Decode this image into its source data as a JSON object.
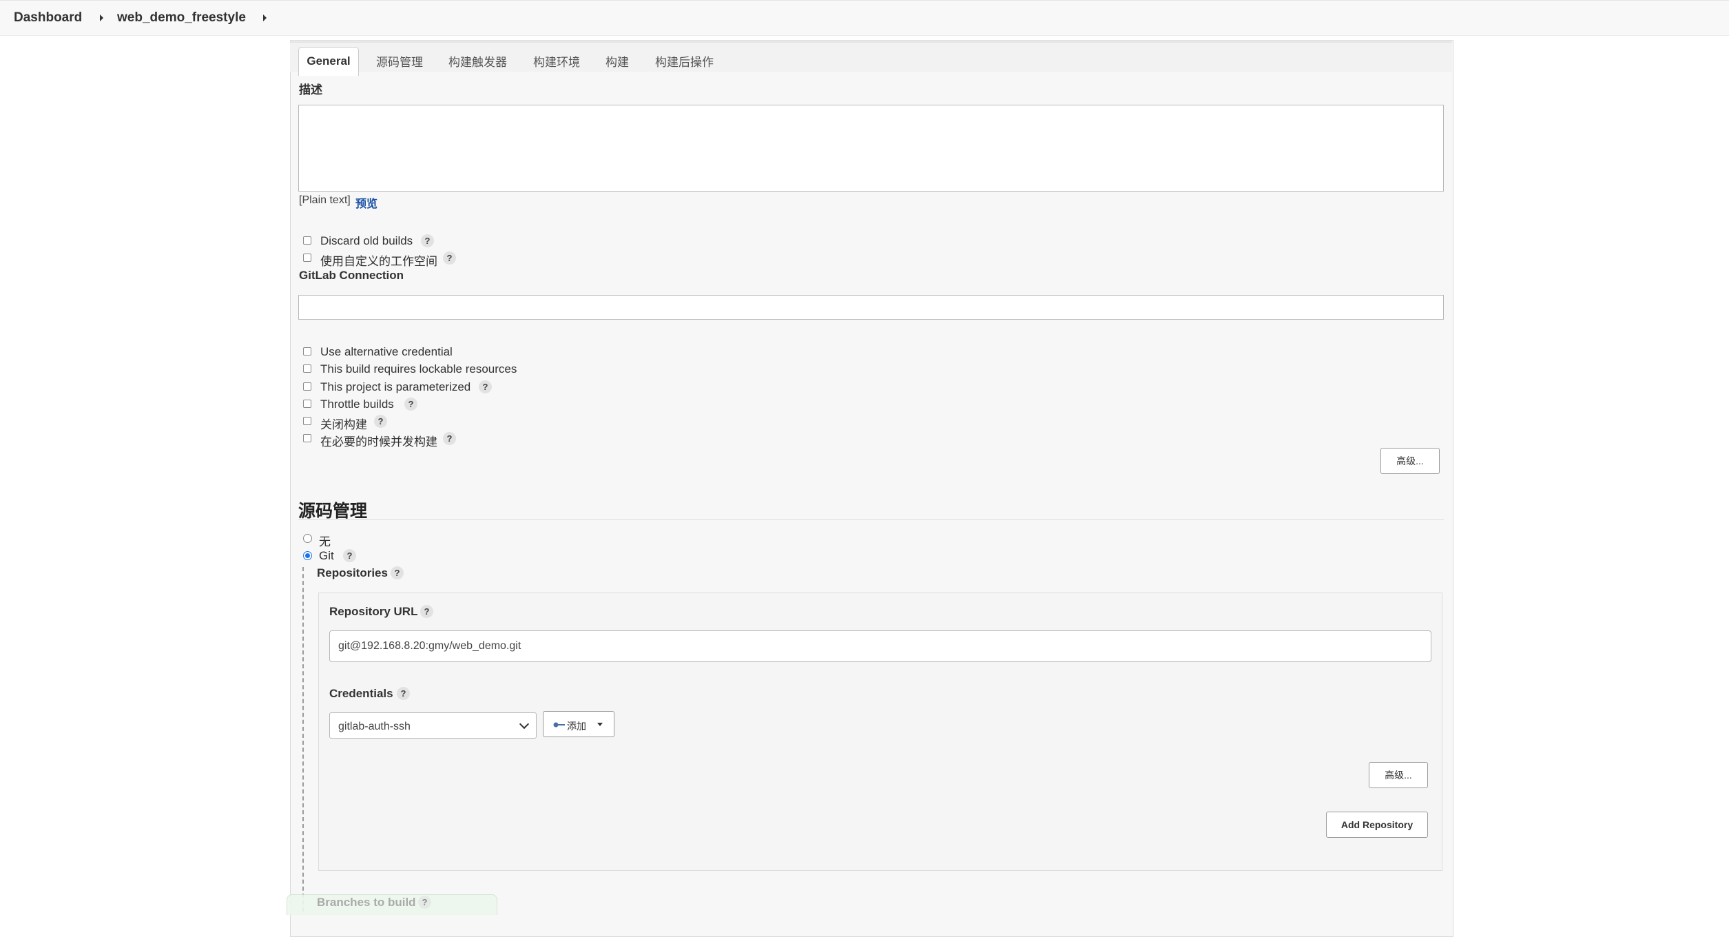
{
  "breadcrumb": {
    "root": "Dashboard",
    "job": "web_demo_freestyle"
  },
  "tabs": [
    "General",
    "源码管理",
    "构建触发器",
    "构建环境",
    "构建",
    "构建后操作"
  ],
  "general": {
    "description_label": "描述",
    "description_value": "",
    "format_note": "[Plain text]",
    "preview_link": "预览",
    "checkboxes_top": [
      {
        "label": "Discard old builds",
        "checked": false
      },
      {
        "label": "使用自定义的工作空间",
        "checked": false
      }
    ],
    "gitlab_connection_label": "GitLab Connection",
    "gitlab_connection_value": "",
    "checkboxes_bottom": [
      {
        "label": "Use alternative credential",
        "checked": false
      },
      {
        "label": "This build requires lockable resources",
        "checked": false
      },
      {
        "label": "This project is parameterized",
        "checked": false
      },
      {
        "label": "Throttle builds",
        "checked": false
      },
      {
        "label": "关闭构建",
        "checked": false
      },
      {
        "label": "在必要的时候并发构建",
        "checked": false
      }
    ],
    "advanced_label": "高级..."
  },
  "scm": {
    "title": "源码管理",
    "options": [
      {
        "label": "无",
        "selected": false
      },
      {
        "label": "Git",
        "selected": true
      }
    ],
    "repositories_label": "Repositories",
    "repository_url_label": "Repository URL",
    "repository_url_value": "git@192.168.8.20:gmy/web_demo.git",
    "credentials_label": "Credentials",
    "credentials_value": "gitlab-auth-ssh",
    "add_button_label": "添加",
    "advanced_label": "高级...",
    "add_repository_label": "Add Repository",
    "branches_label": "Branches to build"
  },
  "help_glyph": "?",
  "colors": {
    "accent": "#1a73e8",
    "link": "#1a4fa3"
  }
}
